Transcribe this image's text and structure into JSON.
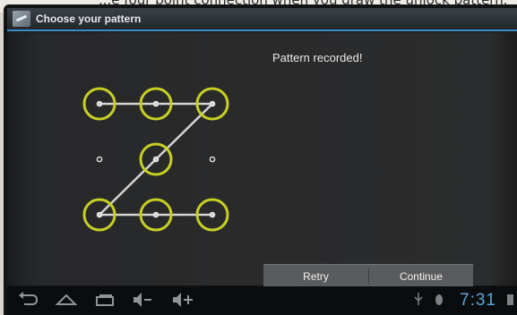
{
  "caption": "...e four point connection when you draw the unlock pattern.",
  "titlebar": {
    "title": "Choose your pattern"
  },
  "main": {
    "status": "Pattern recorded!"
  },
  "buttons": {
    "retry": "Retry",
    "continue": "Continue"
  },
  "navbar": {
    "icons": [
      "back-icon",
      "home-icon",
      "recent-apps-icon",
      "volume-down-icon",
      "volume-up-icon"
    ],
    "status_icons": [
      "usb-icon",
      "debug-icon",
      "battery-icon"
    ],
    "clock": "7:31"
  },
  "pattern": {
    "grid": [
      [
        "dot-1",
        "dot-2",
        "dot-3"
      ],
      [
        "dot-4",
        "dot-5",
        "dot-6"
      ],
      [
        "dot-7",
        "dot-8",
        "dot-9"
      ]
    ],
    "sequence": [
      1,
      2,
      3,
      5,
      7,
      8,
      9
    ],
    "colors": {
      "ring": "#c7d022",
      "line": "#d4d4d4",
      "dot": "#e6e6e6"
    }
  }
}
